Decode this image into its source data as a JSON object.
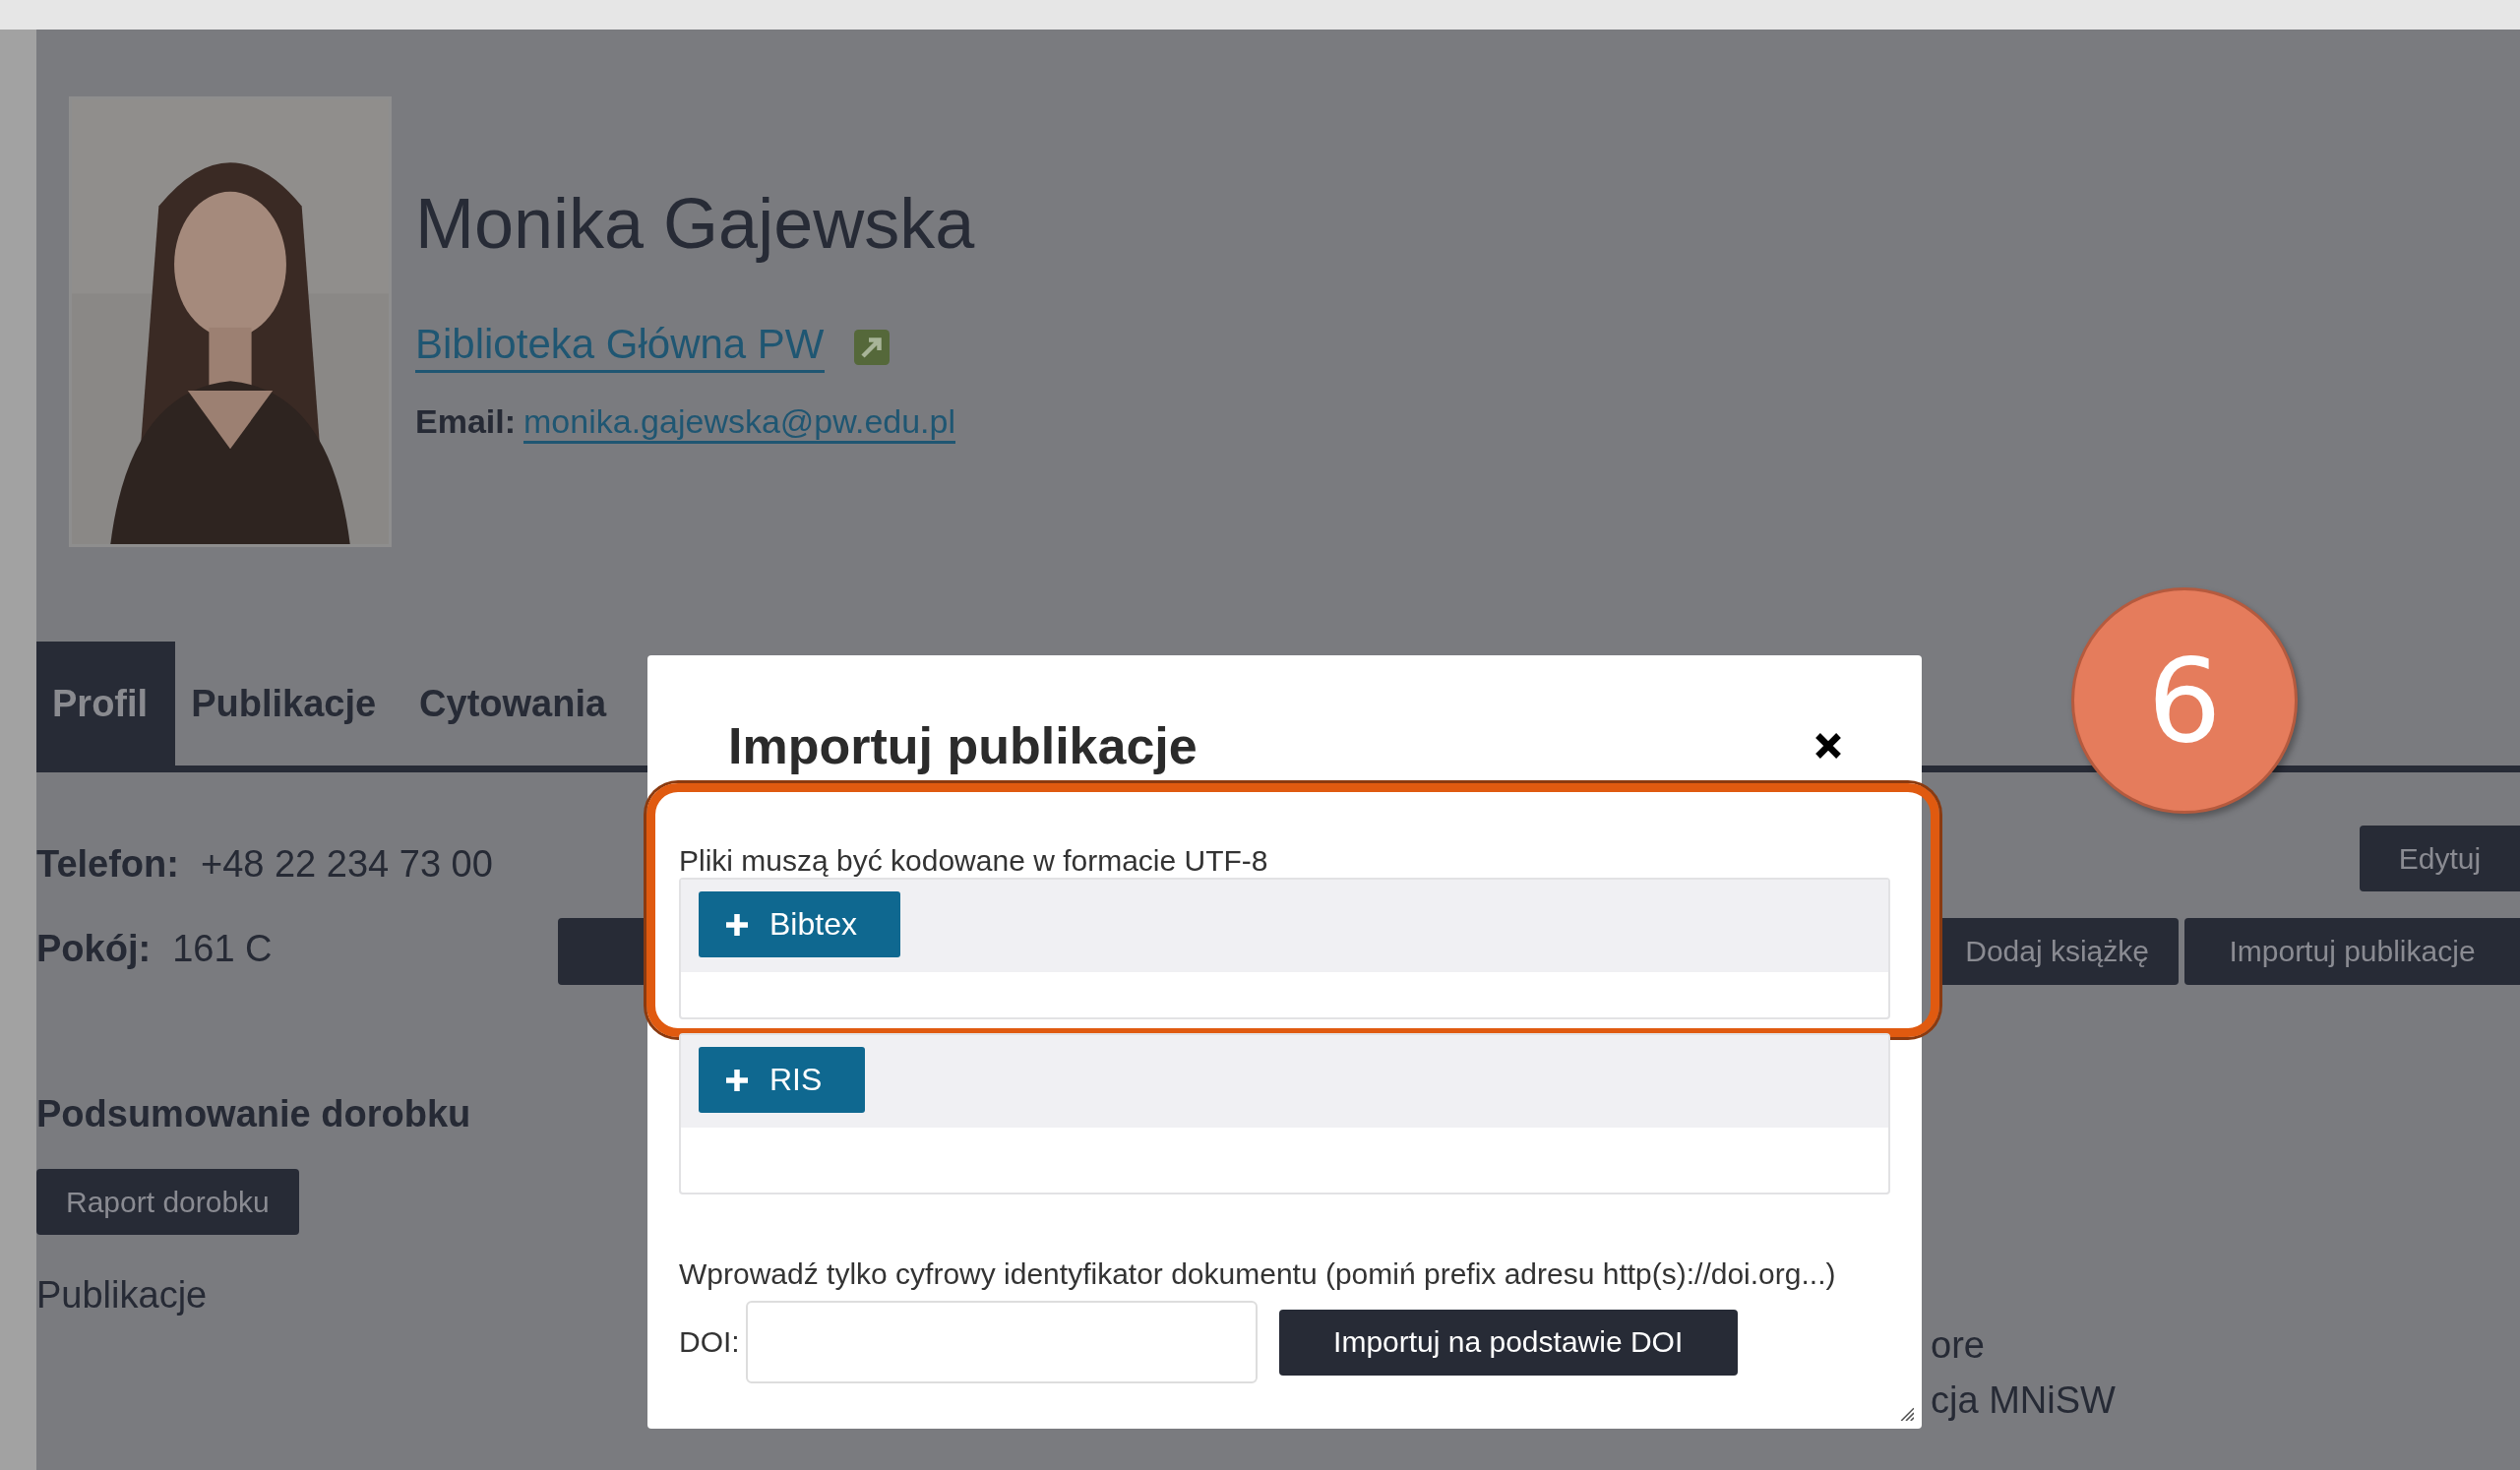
{
  "profile": {
    "name": "Monika Gajewska",
    "affiliation": "Biblioteka Główna PW",
    "email_label": "Email:",
    "email": "monika.gajewska@pw.edu.pl"
  },
  "tabs": [
    {
      "label": "Profil",
      "selected": true
    },
    {
      "label": "Publikacje",
      "selected": false
    },
    {
      "label": "Cytowania",
      "selected": false
    }
  ],
  "contact": [
    {
      "label": "Telefon:",
      "value": "+48 22 234 73 00"
    },
    {
      "label": "Pokój:",
      "value": "161 C"
    }
  ],
  "actions": {
    "edit": "Edytuj",
    "buttons": [
      "Dodaj książkę",
      "Importuj publikacje"
    ]
  },
  "summary": {
    "heading": "Podsumowanie dorobku",
    "report_button": "Raport dorobku",
    "section_label": "Publikacje"
  },
  "behind_modal_texts": [
    "ore",
    "cja MNiSW"
  ],
  "modal": {
    "title": "Importuj publikacje",
    "encoding_note": "Pliki muszą być kodowane w formacie UTF-8",
    "uploads": [
      {
        "label": "Bibtex",
        "highlighted": true
      },
      {
        "label": "RIS",
        "highlighted": false
      }
    ],
    "doi_hint": "Wprowadź tylko cyfrowy identyfikator dokumentu (pomiń prefix adresu http(s)://doi.org...)",
    "doi_label": "DOI:",
    "doi_button": "Importuj na podstawie DOI"
  },
  "annotation": {
    "step": "6"
  }
}
